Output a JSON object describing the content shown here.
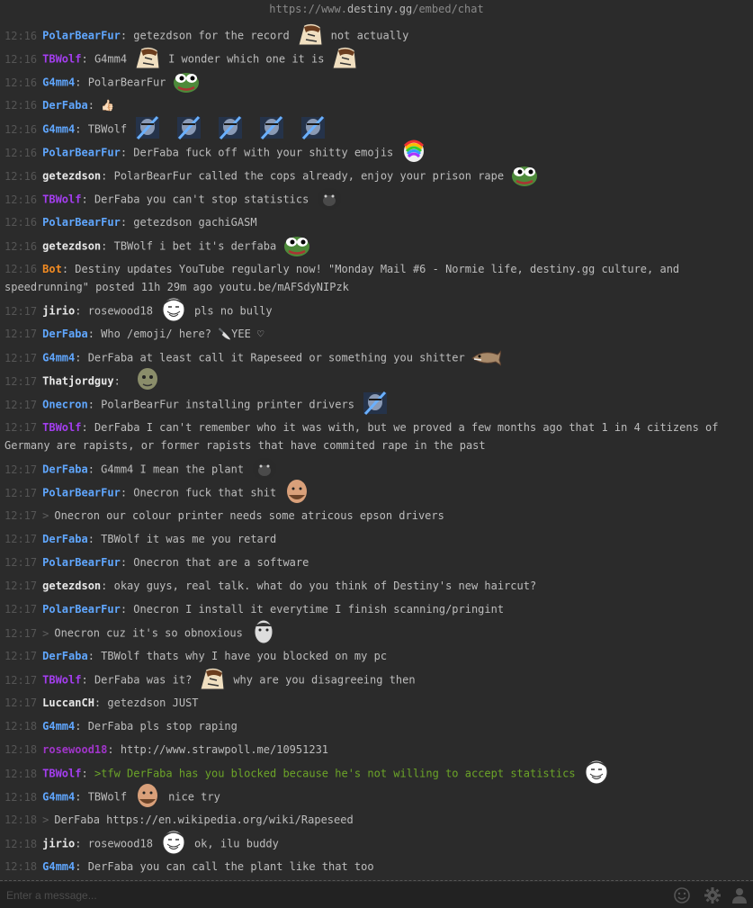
{
  "url": {
    "prefix": "https://www.",
    "host": "destiny.gg",
    "path": "/embed/chat"
  },
  "input": {
    "placeholder": "Enter a message..."
  },
  "colors": {
    "blue": "#60a7ff",
    "purple": "#a43ef0",
    "white": "#e8e8e8",
    "orange": "#f28b22",
    "green_text": "#6ca528"
  },
  "icons": {
    "emote": "smiley-icon",
    "settings": "gear-icon",
    "users": "user-icon"
  },
  "messages": [
    {
      "time": "12:16",
      "user": "PolarBearFur",
      "sep": ": ",
      "text1": "getezdson for the record",
      "emote": "meme-emote",
      "text2": "not actually"
    },
    {
      "time": "12:16",
      "user": "TBWolf",
      "sep": ": ",
      "text1": "G4mm4",
      "emote": "meme-emote",
      "text2": "I wonder which one it is",
      "emote2": "meme-emote"
    },
    {
      "time": "12:16",
      "user": "G4mm4",
      "sep": ": ",
      "text1": "PolarBearFur",
      "emote": "pepe-emote"
    },
    {
      "time": "12:16",
      "user": "DerFaba",
      "sep": ": ",
      "text1": "👍🏻"
    },
    {
      "time": "12:16",
      "user": "G4mm4",
      "sep": ": ",
      "text1": "TBWolf",
      "emotes_count": 5
    },
    {
      "time": "12:16",
      "user": "PolarBearFur",
      "sep": ": ",
      "text1": "DerFaba fuck off with your shitty emojis",
      "emote": "rainbow-emote"
    },
    {
      "time": "12:16",
      "user": "getezdson",
      "sep": ": ",
      "text1": "PolarBearFur called the cops already, enjoy your prison rape",
      "emote": "pepe-emote"
    },
    {
      "time": "12:16",
      "user": "TBWolf",
      "sep": ": ",
      "text1": "DerFaba you can't stop statistics",
      "emote": "gorilla-emote"
    },
    {
      "time": "12:16",
      "user": "PolarBearFur",
      "sep": ": ",
      "text1": "getezdson gachiGASM"
    },
    {
      "time": "12:16",
      "user": "getezdson",
      "sep": ": ",
      "text1": "TBWolf i bet it's derfaba",
      "emote": "pepe-emote"
    },
    {
      "time": "12:16",
      "user": "Bot",
      "sep": ": ",
      "text1": "Destiny updates YouTube regularly now! \"Monday Mail #6 - Normie life, destiny.gg culture, and speedrunning\" posted 11h 29m ago youtu.be/mAFSdyNIPzk"
    },
    {
      "time": "12:17",
      "user": "jirio",
      "sep": ": ",
      "text1": "rosewood18",
      "emote": "face-emote",
      "text2": "pls no bully"
    },
    {
      "time": "12:17",
      "user": "DerFaba",
      "sep": ": ",
      "text1": "Who /emoji/ here? 🔪YEE ♡"
    },
    {
      "time": "12:17",
      "user": "G4mm4",
      "sep": ": ",
      "text1": "DerFaba at least call it Rapeseed or something you shitter",
      "emote": "fish-emote"
    },
    {
      "time": "12:17",
      "user": "Thatjordguy",
      "sep": ": ",
      "text1": "",
      "emote": "goblin-emote"
    },
    {
      "time": "12:17",
      "user": "Onecron",
      "sep": ": ",
      "text1": "PolarBearFur installing printer drivers",
      "emote": "destiny-emote"
    },
    {
      "time": "12:17",
      "user": "TBWolf",
      "sep": ": ",
      "text1": "DerFaba I can't remember who it was with, but we proved a few months ago that 1 in 4 citizens of Germany are rapists, or former rapists that have commited rape in the past"
    },
    {
      "time": "12:17",
      "user": "DerFaba",
      "sep": ": ",
      "text1": "G4mm4 I mean the plant",
      "emote": "gorilla-emote"
    },
    {
      "time": "12:17",
      "user": "PolarBearFur",
      "sep": ": ",
      "text1": "Onecron fuck that shit",
      "emote": "bald-emote"
    },
    {
      "time": "12:17",
      "user": "",
      "sep": "",
      "arrow": ">",
      "text1": "Onecron our colour printer needs some atricous epson drivers"
    },
    {
      "time": "12:17",
      "user": "DerFaba",
      "sep": ": ",
      "text1": "TBWolf it was me you retard"
    },
    {
      "time": "12:17",
      "user": "PolarBearFur",
      "sep": ": ",
      "text1": "Onecron that are a software"
    },
    {
      "time": "12:17",
      "user": "getezdson",
      "sep": ": ",
      "text1": "okay guys, real talk. what do you think of Destiny's new haircut?"
    },
    {
      "time": "12:17",
      "user": "PolarBearFur",
      "sep": ": ",
      "text1": "Onecron I install it everytime I finish scanning/pringint"
    },
    {
      "time": "12:17",
      "user": "",
      "sep": "",
      "arrow": ">",
      "text1": "Onecron cuz it's so obnoxious",
      "emote": "man-emote"
    },
    {
      "time": "12:17",
      "user": "DerFaba",
      "sep": ": ",
      "text1": "TBWolf thats why I have you blocked on my pc"
    },
    {
      "time": "12:17",
      "user": "TBWolf",
      "sep": ": ",
      "text1": "DerFaba was it?",
      "emote": "meme-emote",
      "text2": "why are you disagreeing then"
    },
    {
      "time": "12:17",
      "user": "LuccanCH",
      "sep": ": ",
      "text1": "getezdson JUST"
    },
    {
      "time": "12:18",
      "user": "G4mm4",
      "sep": ": ",
      "text1": "DerFaba pls stop raping"
    },
    {
      "time": "12:18",
      "user": "rosewood18",
      "sep": ": ",
      "text1": "http://www.strawpoll.me/10951231"
    },
    {
      "time": "12:18",
      "user": "TBWolf",
      "sep": ": ",
      "text1": ">tfw DerFaba has you blocked because he's not willing to accept statistics",
      "greentext": true,
      "emote": "face-emote"
    },
    {
      "time": "12:18",
      "user": "G4mm4",
      "sep": ": ",
      "text1": "TBWolf",
      "emote": "bald-emote",
      "text2": "nice try"
    },
    {
      "time": "12:18",
      "user": "",
      "sep": "",
      "arrow": ">",
      "text1": "DerFaba https://en.wikipedia.org/wiki/Rapeseed"
    },
    {
      "time": "12:18",
      "user": "jirio",
      "sep": ": ",
      "text1": "rosewood18",
      "emote": "face-emote",
      "text2": "ok, ilu buddy"
    },
    {
      "time": "12:18",
      "user": "G4mm4",
      "sep": ": ",
      "text1": "DerFaba you can call the plant like that too"
    }
  ]
}
